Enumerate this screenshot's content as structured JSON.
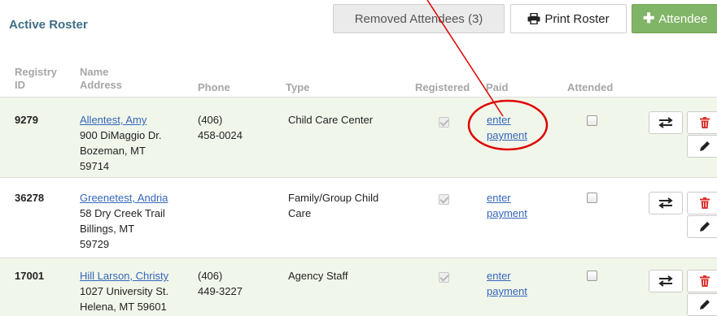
{
  "header": {
    "title": "Active Roster",
    "removed_label": "Removed Attendees (3)",
    "print_label": "Print Roster",
    "add_label": "Attendee"
  },
  "columns": {
    "registry_line1": "Registry",
    "registry_line2": "ID",
    "name_line1": "Name",
    "name_line2": "Address",
    "phone": "Phone",
    "type": "Type",
    "registered": "Registered",
    "paid": "Paid",
    "attended": "Attended"
  },
  "rows": [
    {
      "id": "9279",
      "name": "Allentest, Amy",
      "address": [
        "900 DiMaggio Dr.",
        "Bozeman, MT",
        "59714"
      ],
      "phone": [
        "(406)",
        "458-0024"
      ],
      "type": [
        "Child Care Center"
      ],
      "registered": true,
      "paid_line1": "enter",
      "paid_line2": "payment",
      "attended": false
    },
    {
      "id": "36278",
      "name": "Greenetest, Andria",
      "address": [
        "58 Dry Creek Trail",
        "Billings, MT",
        "59729"
      ],
      "phone": [],
      "type": [
        "Family/Group Child",
        "Care"
      ],
      "registered": true,
      "paid_line1": "enter",
      "paid_line2": "payment",
      "attended": false
    },
    {
      "id": "17001",
      "name": "Hill Larson, Christy",
      "address": [
        "1027 University St.",
        "Helena, MT  59601"
      ],
      "phone": [
        "(406)",
        "449-3227"
      ],
      "type": [
        "Agency Staff"
      ],
      "registered": true,
      "paid_line1": "enter",
      "paid_line2": "payment",
      "attended": false
    }
  ],
  "icons": {
    "print": "printer-icon",
    "add": "plus-icon",
    "transfer": "transfer-arrows-icon",
    "delete": "trash-icon",
    "edit": "pencil-icon"
  },
  "colors": {
    "title": "#3f6e86",
    "link": "#3366bb",
    "add_button": "#80b466",
    "row_highlight": "#f1f6ea",
    "delete_icon": "#d9302c",
    "annotation": "#e00000"
  }
}
